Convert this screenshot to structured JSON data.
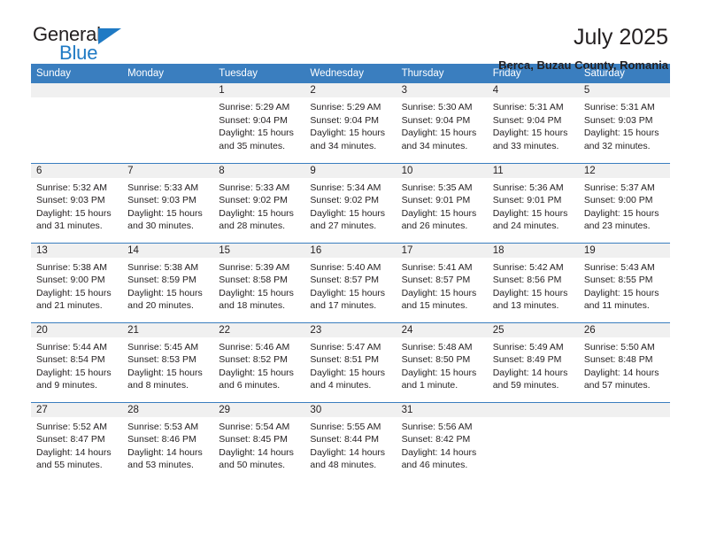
{
  "logo": {
    "line1": "General",
    "line2": "Blue",
    "accent_color": "#1f7ac4"
  },
  "header": {
    "title": "July 2025",
    "subtitle": "Berca, Buzau County, Romania"
  },
  "calendar": {
    "header_color": "#3a7ebf",
    "daynum_band_color": "#f0f0f0",
    "weekday_headers": [
      "Sunday",
      "Monday",
      "Tuesday",
      "Wednesday",
      "Thursday",
      "Friday",
      "Saturday"
    ],
    "weeks": [
      [
        {
          "day": "",
          "sunrise": "",
          "sunset": "",
          "daylight": ""
        },
        {
          "day": "",
          "sunrise": "",
          "sunset": "",
          "daylight": ""
        },
        {
          "day": "1",
          "sunrise": "Sunrise: 5:29 AM",
          "sunset": "Sunset: 9:04 PM",
          "daylight": "Daylight: 15 hours and 35 minutes."
        },
        {
          "day": "2",
          "sunrise": "Sunrise: 5:29 AM",
          "sunset": "Sunset: 9:04 PM",
          "daylight": "Daylight: 15 hours and 34 minutes."
        },
        {
          "day": "3",
          "sunrise": "Sunrise: 5:30 AM",
          "sunset": "Sunset: 9:04 PM",
          "daylight": "Daylight: 15 hours and 34 minutes."
        },
        {
          "day": "4",
          "sunrise": "Sunrise: 5:31 AM",
          "sunset": "Sunset: 9:04 PM",
          "daylight": "Daylight: 15 hours and 33 minutes."
        },
        {
          "day": "5",
          "sunrise": "Sunrise: 5:31 AM",
          "sunset": "Sunset: 9:03 PM",
          "daylight": "Daylight: 15 hours and 32 minutes."
        }
      ],
      [
        {
          "day": "6",
          "sunrise": "Sunrise: 5:32 AM",
          "sunset": "Sunset: 9:03 PM",
          "daylight": "Daylight: 15 hours and 31 minutes."
        },
        {
          "day": "7",
          "sunrise": "Sunrise: 5:33 AM",
          "sunset": "Sunset: 9:03 PM",
          "daylight": "Daylight: 15 hours and 30 minutes."
        },
        {
          "day": "8",
          "sunrise": "Sunrise: 5:33 AM",
          "sunset": "Sunset: 9:02 PM",
          "daylight": "Daylight: 15 hours and 28 minutes."
        },
        {
          "day": "9",
          "sunrise": "Sunrise: 5:34 AM",
          "sunset": "Sunset: 9:02 PM",
          "daylight": "Daylight: 15 hours and 27 minutes."
        },
        {
          "day": "10",
          "sunrise": "Sunrise: 5:35 AM",
          "sunset": "Sunset: 9:01 PM",
          "daylight": "Daylight: 15 hours and 26 minutes."
        },
        {
          "day": "11",
          "sunrise": "Sunrise: 5:36 AM",
          "sunset": "Sunset: 9:01 PM",
          "daylight": "Daylight: 15 hours and 24 minutes."
        },
        {
          "day": "12",
          "sunrise": "Sunrise: 5:37 AM",
          "sunset": "Sunset: 9:00 PM",
          "daylight": "Daylight: 15 hours and 23 minutes."
        }
      ],
      [
        {
          "day": "13",
          "sunrise": "Sunrise: 5:38 AM",
          "sunset": "Sunset: 9:00 PM",
          "daylight": "Daylight: 15 hours and 21 minutes."
        },
        {
          "day": "14",
          "sunrise": "Sunrise: 5:38 AM",
          "sunset": "Sunset: 8:59 PM",
          "daylight": "Daylight: 15 hours and 20 minutes."
        },
        {
          "day": "15",
          "sunrise": "Sunrise: 5:39 AM",
          "sunset": "Sunset: 8:58 PM",
          "daylight": "Daylight: 15 hours and 18 minutes."
        },
        {
          "day": "16",
          "sunrise": "Sunrise: 5:40 AM",
          "sunset": "Sunset: 8:57 PM",
          "daylight": "Daylight: 15 hours and 17 minutes."
        },
        {
          "day": "17",
          "sunrise": "Sunrise: 5:41 AM",
          "sunset": "Sunset: 8:57 PM",
          "daylight": "Daylight: 15 hours and 15 minutes."
        },
        {
          "day": "18",
          "sunrise": "Sunrise: 5:42 AM",
          "sunset": "Sunset: 8:56 PM",
          "daylight": "Daylight: 15 hours and 13 minutes."
        },
        {
          "day": "19",
          "sunrise": "Sunrise: 5:43 AM",
          "sunset": "Sunset: 8:55 PM",
          "daylight": "Daylight: 15 hours and 11 minutes."
        }
      ],
      [
        {
          "day": "20",
          "sunrise": "Sunrise: 5:44 AM",
          "sunset": "Sunset: 8:54 PM",
          "daylight": "Daylight: 15 hours and 9 minutes."
        },
        {
          "day": "21",
          "sunrise": "Sunrise: 5:45 AM",
          "sunset": "Sunset: 8:53 PM",
          "daylight": "Daylight: 15 hours and 8 minutes."
        },
        {
          "day": "22",
          "sunrise": "Sunrise: 5:46 AM",
          "sunset": "Sunset: 8:52 PM",
          "daylight": "Daylight: 15 hours and 6 minutes."
        },
        {
          "day": "23",
          "sunrise": "Sunrise: 5:47 AM",
          "sunset": "Sunset: 8:51 PM",
          "daylight": "Daylight: 15 hours and 4 minutes."
        },
        {
          "day": "24",
          "sunrise": "Sunrise: 5:48 AM",
          "sunset": "Sunset: 8:50 PM",
          "daylight": "Daylight: 15 hours and 1 minute."
        },
        {
          "day": "25",
          "sunrise": "Sunrise: 5:49 AM",
          "sunset": "Sunset: 8:49 PM",
          "daylight": "Daylight: 14 hours and 59 minutes."
        },
        {
          "day": "26",
          "sunrise": "Sunrise: 5:50 AM",
          "sunset": "Sunset: 8:48 PM",
          "daylight": "Daylight: 14 hours and 57 minutes."
        }
      ],
      [
        {
          "day": "27",
          "sunrise": "Sunrise: 5:52 AM",
          "sunset": "Sunset: 8:47 PM",
          "daylight": "Daylight: 14 hours and 55 minutes."
        },
        {
          "day": "28",
          "sunrise": "Sunrise: 5:53 AM",
          "sunset": "Sunset: 8:46 PM",
          "daylight": "Daylight: 14 hours and 53 minutes."
        },
        {
          "day": "29",
          "sunrise": "Sunrise: 5:54 AM",
          "sunset": "Sunset: 8:45 PM",
          "daylight": "Daylight: 14 hours and 50 minutes."
        },
        {
          "day": "30",
          "sunrise": "Sunrise: 5:55 AM",
          "sunset": "Sunset: 8:44 PM",
          "daylight": "Daylight: 14 hours and 48 minutes."
        },
        {
          "day": "31",
          "sunrise": "Sunrise: 5:56 AM",
          "sunset": "Sunset: 8:42 PM",
          "daylight": "Daylight: 14 hours and 46 minutes."
        },
        {
          "day": "",
          "sunrise": "",
          "sunset": "",
          "daylight": ""
        },
        {
          "day": "",
          "sunrise": "",
          "sunset": "",
          "daylight": ""
        }
      ]
    ]
  }
}
